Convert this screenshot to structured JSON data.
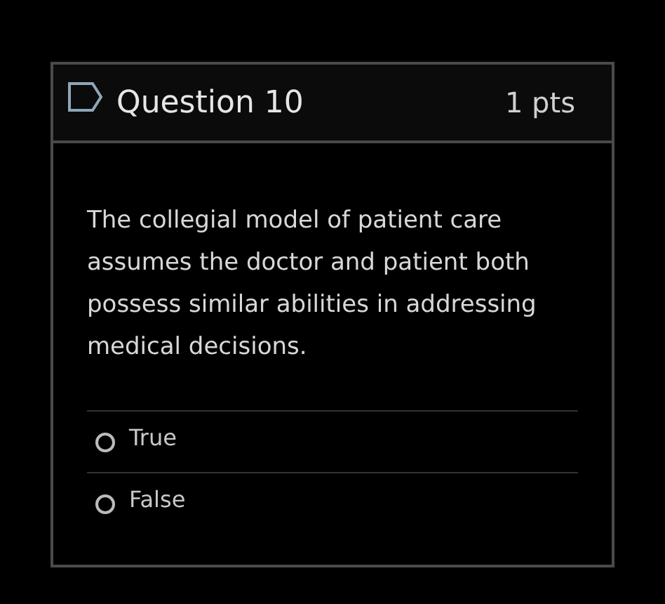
{
  "question": {
    "title": "Question 10",
    "points": "1 pts",
    "text": "The collegial model of patient care assumes the doctor and patient both possess similar abilities in addressing medical decisions.",
    "options": [
      {
        "label": "True",
        "selected": false
      },
      {
        "label": "False",
        "selected": false
      }
    ]
  }
}
